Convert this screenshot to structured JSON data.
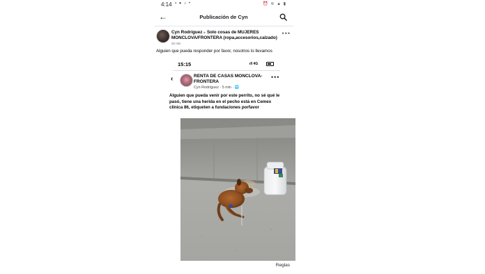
{
  "status_bar": {
    "time": "4:14",
    "notification_icons": "▪ ● ♪ •",
    "system_icons": "⏰ ≋ ▲ ▮"
  },
  "app_bar": {
    "title": "Publicación de Cyn",
    "back_icon": "arrow-left",
    "search_icon": "magnifier"
  },
  "post": {
    "author": "Cyn Rodríguez",
    "separator": "▸",
    "group": "Solo cosas de MUJERES MONCLOVA/FRONTERA  (ropa,accesorios,calzado)",
    "time": "32 min",
    "more": "•••",
    "text": "Alguien que pueda responder por favor, nosotros lo llevamos"
  },
  "shared_screenshot": {
    "status_time": "15:15",
    "status_network": "ıll 4G",
    "back": "‹",
    "group": "RENTA DE CASAS MONCLOVA-FRONTERA",
    "author_time": "Cyn Rodríguez · 5 min · 🌐",
    "more": "•••",
    "text": "Alguien que pueda venir por este perrito, no sé qué le pasó, tiene una herida en el pecho está en Cemex clínica 86, etiqueten a fundaciones porfavor"
  },
  "footer": {
    "rules_link": "Reglas"
  },
  "colors": {
    "text": "#050505",
    "secondary_text": "#65676b",
    "divider": "#e4e6eb",
    "concrete": "#a9a9a6"
  }
}
